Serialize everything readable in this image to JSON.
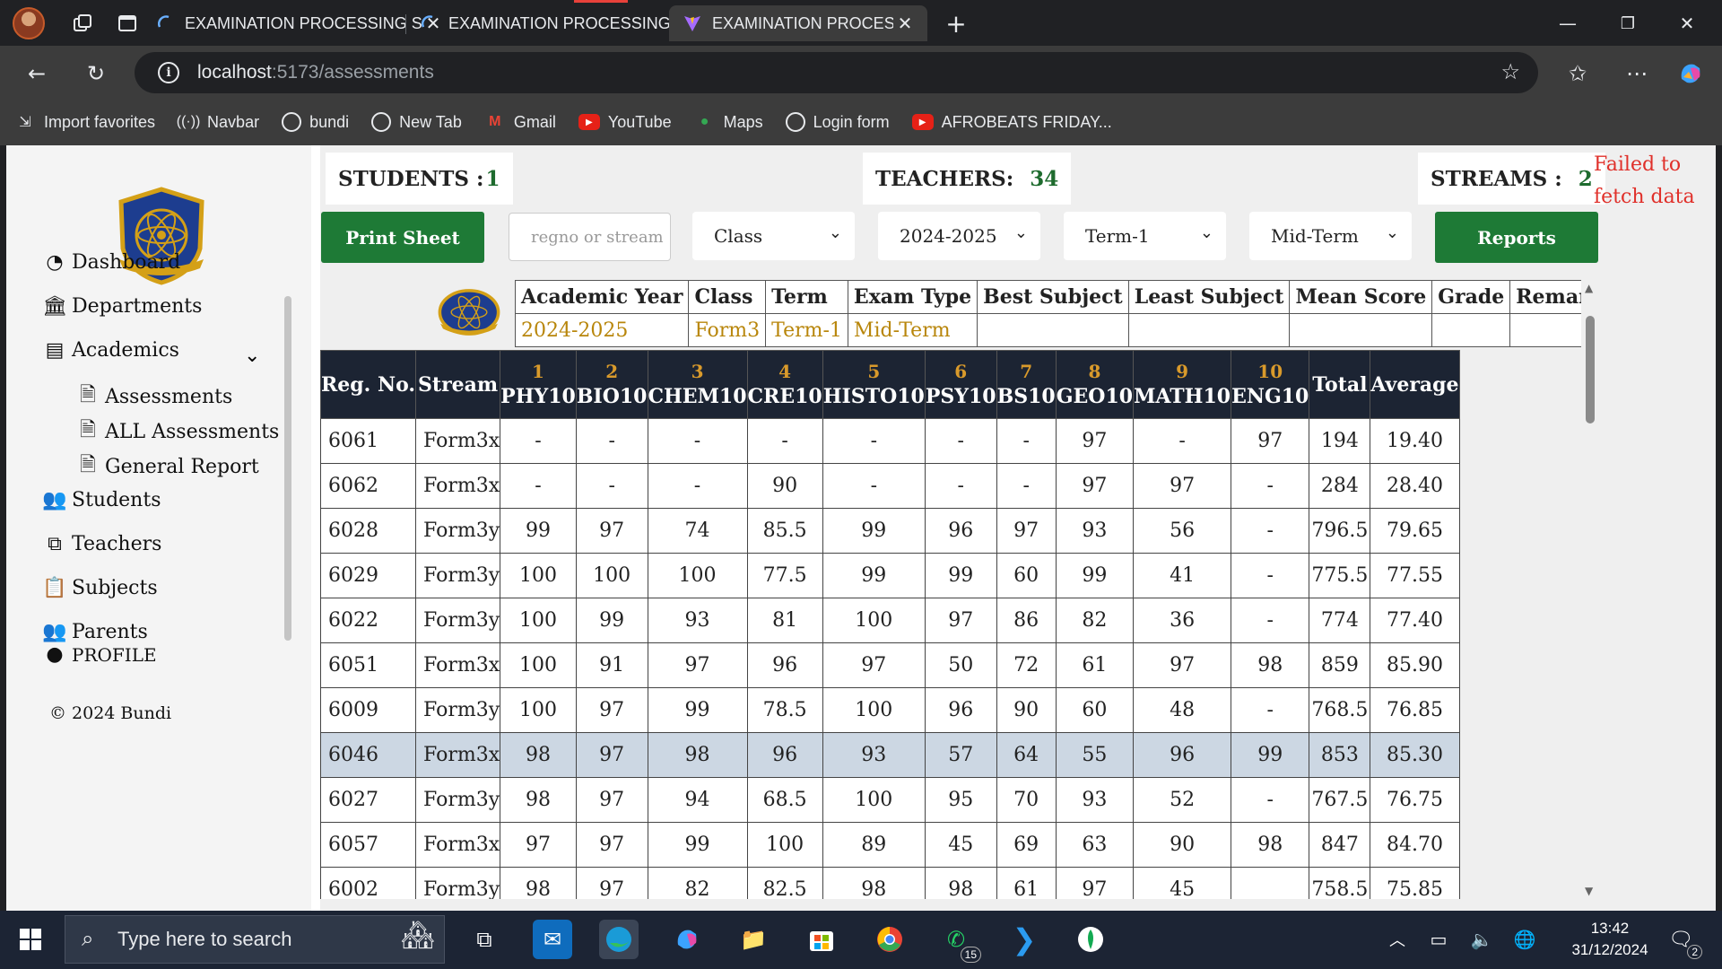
{
  "browser": {
    "tabs": [
      {
        "title": "EXAMINATION PROCESSING SYST",
        "active": false
      },
      {
        "title": "EXAMINATION PROCESSING SYST",
        "active": false
      },
      {
        "title": "EXAMINATION PROCESSING SYST",
        "active": true
      }
    ],
    "url_host": "localhost",
    "url_path": ":5173/assessments",
    "bookmarks": [
      {
        "label": "Import favorites",
        "icon": "import-icon"
      },
      {
        "label": "Navbar",
        "icon": "radio-icon"
      },
      {
        "label": "bundi",
        "icon": "globe-icon"
      },
      {
        "label": "New Tab",
        "icon": "globe-icon"
      },
      {
        "label": "Gmail",
        "icon": "gmail-icon"
      },
      {
        "label": "YouTube",
        "icon": "youtube-icon"
      },
      {
        "label": "Maps",
        "icon": "maps-icon"
      },
      {
        "label": "Login form",
        "icon": "globe-icon"
      },
      {
        "label": "AFROBEATS FRIDAY...",
        "icon": "youtube-icon"
      }
    ]
  },
  "sidebar": {
    "items": [
      {
        "label": "Dashboard",
        "icon": "dashboard-icon"
      },
      {
        "label": "Departments",
        "icon": "building-icon"
      },
      {
        "label": "Academics",
        "icon": "book-icon"
      },
      {
        "label": "Assessments",
        "icon": "document-icon"
      },
      {
        "label": "ALL Assessments",
        "icon": "document-icon"
      },
      {
        "label": "General Report",
        "icon": "document-icon"
      },
      {
        "label": "Students",
        "icon": "users-icon"
      },
      {
        "label": "Teachers",
        "icon": "teacher-icon"
      },
      {
        "label": "Subjects",
        "icon": "clipboard-icon"
      },
      {
        "label": "Parents",
        "icon": "users-icon"
      }
    ],
    "profile_label": "PROFILE",
    "copyright": "© 2024 Bundi"
  },
  "stats": {
    "students_label": "STUDENTS :",
    "students_value": "1",
    "teachers_label": "TEACHERS:",
    "teachers_value": "34",
    "streams_label": "STREAMS :",
    "streams_value": "2",
    "error": "Failed to fetch data"
  },
  "toolbar": {
    "print_label": "Print Sheet",
    "search_placeholder": "regno or stream",
    "class_value": "Class",
    "year_value": "2024-2025",
    "term_value": "Term-1",
    "exam_value": "Mid-Term",
    "reports_label": "Reports"
  },
  "summary": {
    "headers": [
      "Academic Year",
      "Class",
      "Term",
      "Exam Type",
      "Best Subject",
      "Least Subject",
      "Mean Score",
      "Grade",
      "Remark"
    ],
    "values": [
      "2024-2025",
      "Form3",
      "Term-1",
      "Mid-Term",
      "",
      "",
      "",
      "",
      ""
    ]
  },
  "marks": {
    "reg_header": "Reg. No.",
    "stream_header": "Stream",
    "total_header": "Total",
    "average_header": "Average",
    "subjects": [
      {
        "num": "1",
        "code": "PHY10"
      },
      {
        "num": "2",
        "code": "BIO10"
      },
      {
        "num": "3",
        "code": "CHEM10"
      },
      {
        "num": "4",
        "code": "CRE10"
      },
      {
        "num": "5",
        "code": "HISTO10"
      },
      {
        "num": "6",
        "code": "PSY10"
      },
      {
        "num": "7",
        "code": "BS10"
      },
      {
        "num": "8",
        "code": "GEO10"
      },
      {
        "num": "9",
        "code": "MATH10"
      },
      {
        "num": "10",
        "code": "ENG10"
      }
    ],
    "rows": [
      {
        "reg": "6061",
        "stream": "Form3x",
        "scores": [
          "-",
          "-",
          "-",
          "-",
          "-",
          "-",
          "-",
          "97",
          "-",
          "97"
        ],
        "total": "194",
        "average": "19.40"
      },
      {
        "reg": "6062",
        "stream": "Form3x",
        "scores": [
          "-",
          "-",
          "-",
          "90",
          "-",
          "-",
          "-",
          "97",
          "97",
          "-"
        ],
        "total": "284",
        "average": "28.40"
      },
      {
        "reg": "6028",
        "stream": "Form3y",
        "scores": [
          "99",
          "97",
          "74",
          "85.5",
          "99",
          "96",
          "97",
          "93",
          "56",
          "-"
        ],
        "total": "796.5",
        "average": "79.65"
      },
      {
        "reg": "6029",
        "stream": "Form3y",
        "scores": [
          "100",
          "100",
          "100",
          "77.5",
          "99",
          "99",
          "60",
          "99",
          "41",
          "-"
        ],
        "total": "775.5",
        "average": "77.55"
      },
      {
        "reg": "6022",
        "stream": "Form3y",
        "scores": [
          "100",
          "99",
          "93",
          "81",
          "100",
          "97",
          "86",
          "82",
          "36",
          "-"
        ],
        "total": "774",
        "average": "77.40"
      },
      {
        "reg": "6051",
        "stream": "Form3x",
        "scores": [
          "100",
          "91",
          "97",
          "96",
          "97",
          "50",
          "72",
          "61",
          "97",
          "98"
        ],
        "total": "859",
        "average": "85.90"
      },
      {
        "reg": "6009",
        "stream": "Form3y",
        "scores": [
          "100",
          "97",
          "99",
          "78.5",
          "100",
          "96",
          "90",
          "60",
          "48",
          "-"
        ],
        "total": "768.5",
        "average": "76.85"
      },
      {
        "reg": "6046",
        "stream": "Form3x",
        "scores": [
          "98",
          "97",
          "98",
          "96",
          "93",
          "57",
          "64",
          "55",
          "96",
          "99"
        ],
        "total": "853",
        "average": "85.30",
        "highlighted": true
      },
      {
        "reg": "6027",
        "stream": "Form3y",
        "scores": [
          "98",
          "97",
          "94",
          "68.5",
          "100",
          "95",
          "70",
          "93",
          "52",
          "-"
        ],
        "total": "767.5",
        "average": "76.75"
      },
      {
        "reg": "6057",
        "stream": "Form3x",
        "scores": [
          "97",
          "97",
          "99",
          "100",
          "89",
          "45",
          "69",
          "63",
          "90",
          "98"
        ],
        "total": "847",
        "average": "84.70"
      },
      {
        "reg": "6002",
        "stream": "Form3y",
        "scores": [
          "98",
          "97",
          "82",
          "82.5",
          "98",
          "98",
          "61",
          "97",
          "45",
          ""
        ],
        "total": "758.5",
        "average": "75.85"
      }
    ]
  },
  "taskbar": {
    "search_placeholder": "Type here to search",
    "time": "13:42",
    "date": "31/12/2024",
    "whatsapp_badge": "15",
    "notification_badge": "2"
  },
  "colors": {
    "green_button": "#1e7a36",
    "header_dark": "#1c2433",
    "subject_number": "#d99a2b",
    "summary_value": "#b8860b",
    "error_text": "#e0302a",
    "highlight_row": "#ccd7e3"
  }
}
